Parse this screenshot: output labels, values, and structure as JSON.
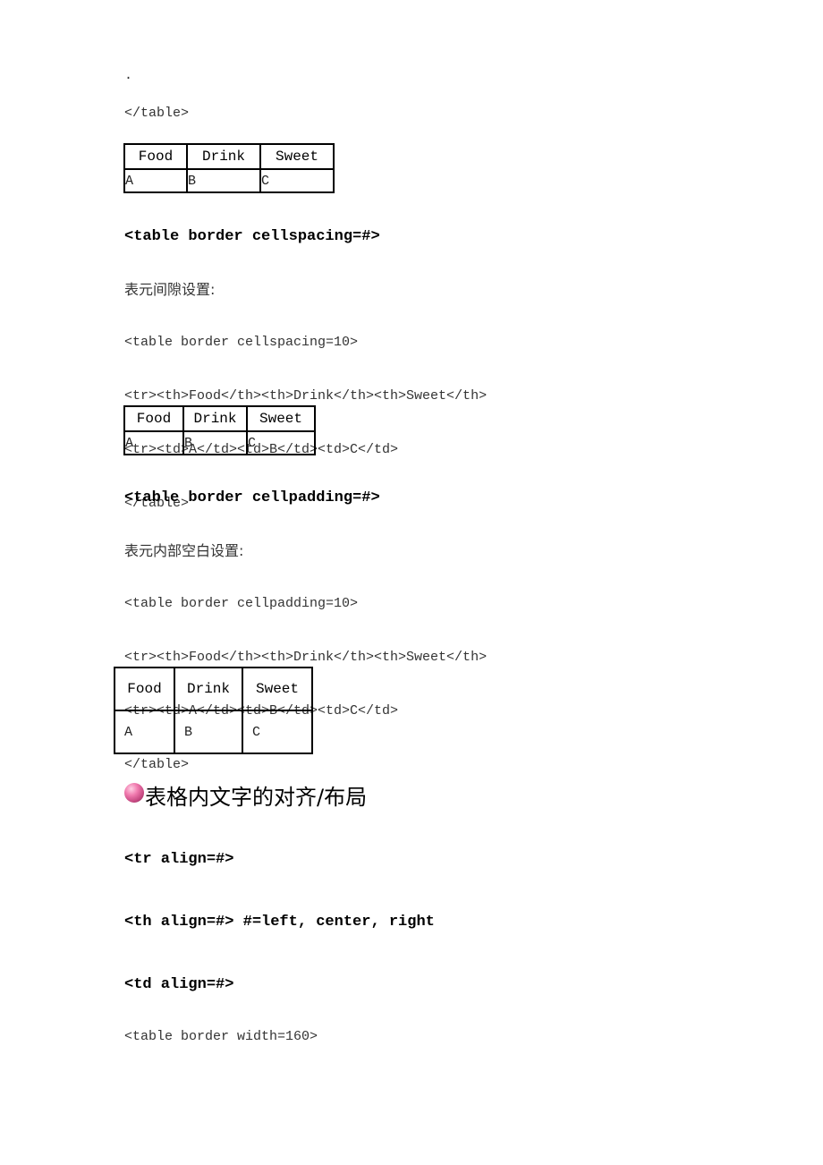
{
  "document": {
    "top_dot": ".",
    "top_code_close": "</table>",
    "table1": {
      "headers": [
        "Food",
        "Drink",
        "Sweet"
      ],
      "cells": [
        "A",
        "B",
        "C"
      ]
    },
    "section_cellspacing": {
      "title": "<table border cellspacing=#>",
      "description": "表元间隙设置:",
      "code_lines": [
        "<table border cellspacing=10>",
        "<tr><th>Food</th><th>Drink</th><th>Sweet</th>",
        "<tr><td>A</td><td>B</td><td>C</td>",
        "</table>"
      ],
      "table": {
        "headers": [
          "Food",
          "Drink",
          "Sweet"
        ],
        "cells": [
          "A",
          "B",
          "C"
        ]
      }
    },
    "section_cellpadding": {
      "title": "<table border cellpadding=#>",
      "description": "表元内部空白设置:",
      "code_lines": [
        "<table border cellpadding=10>",
        "<tr><th>Food</th><th>Drink</th><th>Sweet</th>",
        "<tr><td>A</td><td>B</td><td>C</td>",
        "</table>"
      ],
      "table": {
        "headers": [
          "Food",
          "Drink",
          "Sweet"
        ],
        "cells": [
          "A",
          "B",
          "C"
        ]
      }
    },
    "section_align": {
      "heading": "表格内文字的对齐/布局",
      "bullet_icon": "pink-sphere-bullet",
      "bullet_color": "#e0609a",
      "items": [
        "<tr align=#>",
        "<th align=#> #=left, center, right",
        "<td align=#>"
      ],
      "code_line": "<table border width=160>"
    }
  }
}
